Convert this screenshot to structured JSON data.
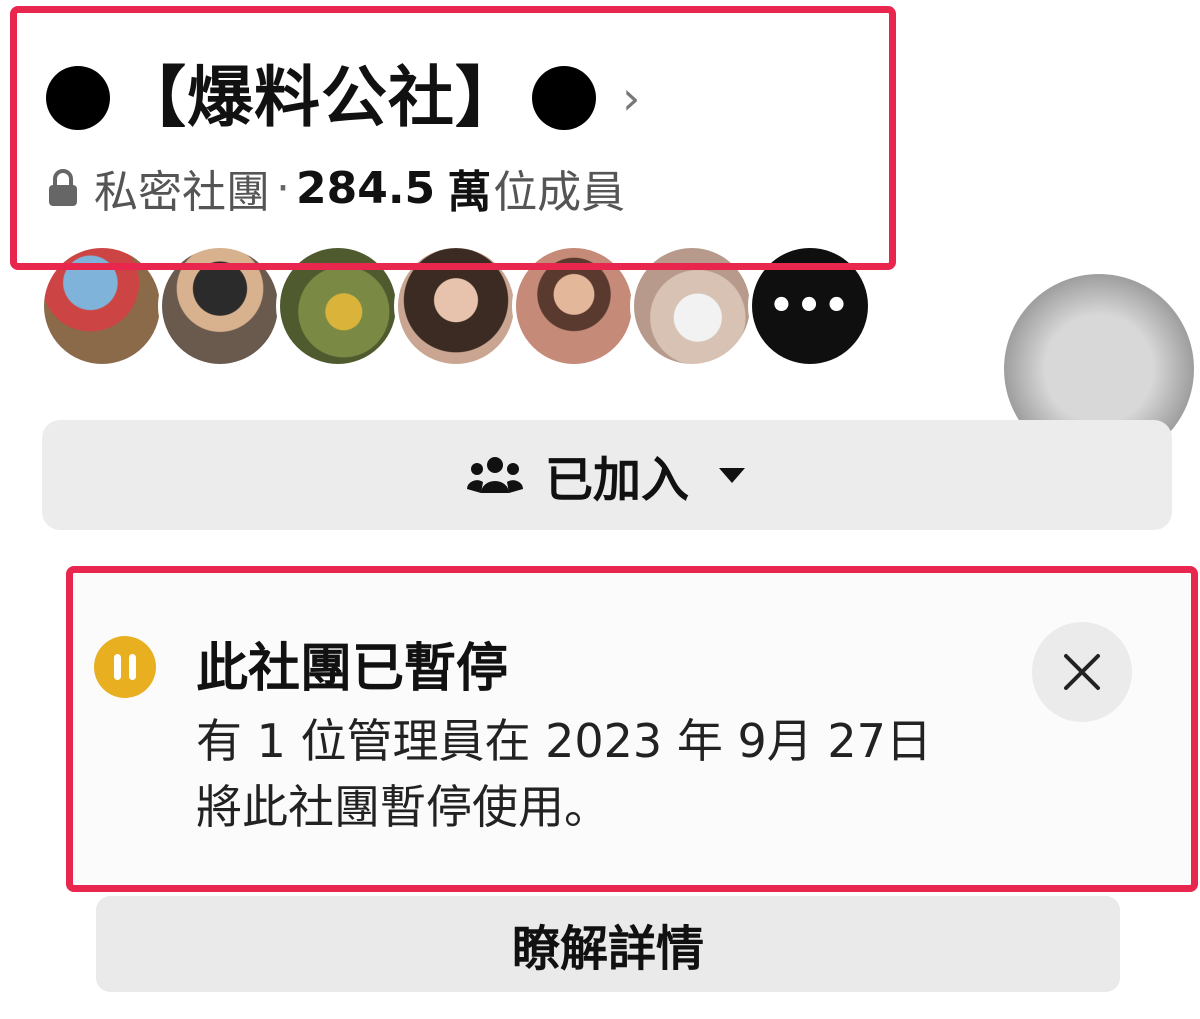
{
  "group": {
    "name": "【爆料公社】",
    "privacy": "私密社團",
    "separator": "·",
    "member_count": "284.5",
    "member_unit": "萬",
    "member_label": "位成員",
    "chevron": "›"
  },
  "members_preview": {
    "more_label": "•••"
  },
  "join_button": {
    "label": "已加入",
    "icon": "group-icon",
    "dropdown_icon": "caret-down-icon"
  },
  "notice": {
    "title": "此社團已暫停",
    "body_line1": "有 1 位管理員在 2023 年 9月 27日",
    "body_line2": "將此社團暫停使用。",
    "icon": "pause-icon",
    "close_icon": "close-icon"
  },
  "learn_more": {
    "label": "瞭解詳情"
  },
  "colors": {
    "highlight_box": "#e8264e",
    "pause_icon": "#e8b020",
    "button_bg": "#ececec"
  }
}
